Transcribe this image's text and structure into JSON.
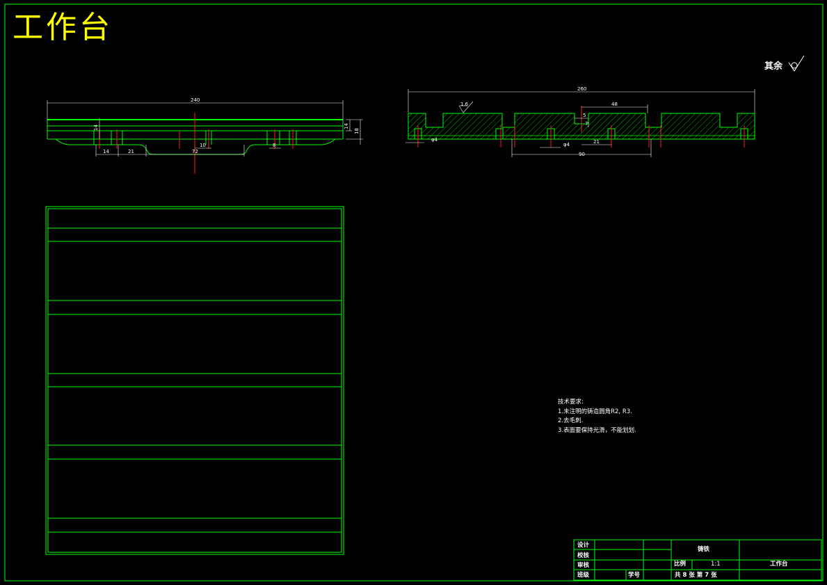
{
  "drawing": {
    "title": "工作台",
    "roughness_note": "其余",
    "colors": {
      "background": "#000000",
      "outline": "#00ff00",
      "hatch": "#00b800",
      "centerline": "#ff2020",
      "dimension": "#ffffff",
      "title": "#ffff00"
    },
    "left_view": {
      "dims": {
        "overall_length": "240",
        "thickness_1": "14",
        "thickness_2": "18",
        "height": "14",
        "d_14": "14",
        "d_21": "21",
        "d_72": "72",
        "d_10": "10",
        "d_8": "8"
      }
    },
    "right_view": {
      "dims": {
        "overall_length": "260",
        "d_48": "48",
        "d_5": "5",
        "d_7": "7",
        "phi_4_left": "φ4",
        "phi_4_mid": "φ4",
        "d_21": "21",
        "d_90": "90",
        "surface_roughness": "1.6"
      }
    },
    "technical_requirements": {
      "heading": "技术要求:",
      "items": [
        "1.未注明的铸造圆角R2, R3.",
        "2.去毛刺.",
        "3.表面要保持光滑，不能划划."
      ]
    },
    "title_block": {
      "designer_label": "设计",
      "checker_label": "校核",
      "reviewer_label": "审核",
      "class_label": "班级",
      "student_no_label": "学号",
      "material": "铸铁",
      "scale_label": "比例",
      "scale_value": "1:1",
      "sheet_info": "共 8  张   第 7  张",
      "part_name": "工作台"
    }
  }
}
